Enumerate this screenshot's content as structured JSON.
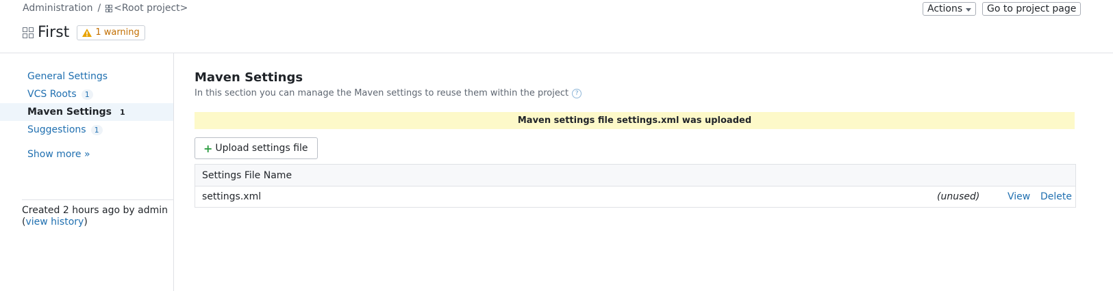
{
  "breadcrumb": {
    "admin": "Administration",
    "sep": "/",
    "root": "<Root project>"
  },
  "page": {
    "title": "First",
    "warning": "1 warning"
  },
  "top_actions": {
    "actions": "Actions",
    "go_to_project": "Go to project page"
  },
  "sidebar": {
    "items": [
      {
        "label": "General Settings",
        "count": ""
      },
      {
        "label": "VCS Roots",
        "count": "1"
      },
      {
        "label": "Maven Settings",
        "count": "1"
      },
      {
        "label": "Suggestions",
        "count": "1"
      }
    ],
    "show_more": "Show more »",
    "created_text": "Created 2 hours ago by admin",
    "open_paren": "(",
    "view_history": "view history",
    "close_paren": ")"
  },
  "main": {
    "title": "Maven Settings",
    "description": "In this section you can manage the Maven settings to reuse them within the project",
    "notice": "Maven settings file settings.xml was uploaded",
    "upload_label": "Upload settings file",
    "table": {
      "header": "Settings File Name",
      "rows": [
        {
          "name": "settings.xml",
          "status": "(unused)",
          "view": "View",
          "delete": "Delete"
        }
      ]
    }
  },
  "colors": {
    "link": "#1f6fb0",
    "warning": "#c26e00",
    "notice_bg": "#fdf9c9",
    "active_bg": "#eef5fb"
  }
}
